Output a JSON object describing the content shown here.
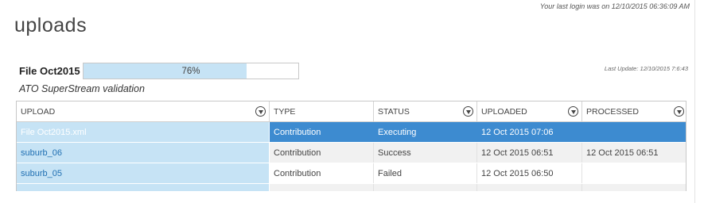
{
  "header": {
    "last_login": "Your last login was on 12/10/2015 06:36:09 AM",
    "page_title": "uploads"
  },
  "file": {
    "name": "File Oct2015",
    "progress_percent": 76,
    "progress_label": "76%",
    "last_update": "Last Update: 12/10/2015 7:6:43",
    "subtitle": "ATO SuperStream validation"
  },
  "grid": {
    "columns": [
      "UPLOAD",
      "TYPE",
      "STATUS",
      "UPLOADED",
      "PROCESSED"
    ],
    "filter_icon": "filter-icon",
    "rows": [
      {
        "upload": "File Oct2015.xml",
        "type": "Contribution",
        "status": "Executing",
        "uploaded": "12 Oct 2015 07:06",
        "processed": ""
      },
      {
        "upload": "suburb_06",
        "type": "Contribution",
        "status": "Success",
        "uploaded": "12 Oct 2015 06:51",
        "processed": "12 Oct 2015 06:51"
      },
      {
        "upload": "suburb_05",
        "type": "Contribution",
        "status": "Failed",
        "uploaded": "12 Oct 2015 06:50",
        "processed": ""
      }
    ]
  },
  "colors": {
    "selected_row": "#3d8bd0",
    "upload_column": "#c6e3f5",
    "progress_fill": "#c6e3f5",
    "link": "#1f6fb2"
  }
}
